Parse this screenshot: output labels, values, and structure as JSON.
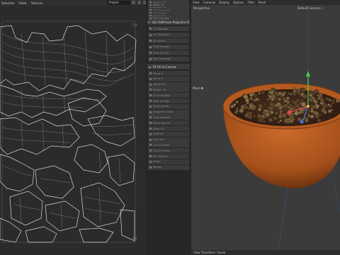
{
  "uv_editor": {
    "menu": [
      "Selection",
      "Fields",
      "Textures"
    ],
    "dropdown": "Project",
    "tick_top": "1.0",
    "tick_bottom": "1.0"
  },
  "operator_panel": {
    "items_top": [
      "Unfold UVs",
      "Relax UV",
      "Realign UV",
      "Fit UV Islands",
      "UV Islands",
      "Orient UV",
      "Fit to Canvas"
    ],
    "section1_title": "Set UVW from Projection",
    "items_mid": [
      "UV Manager",
      "UV Transform",
      "UV Layout",
      "UVW Remesh",
      "Snap to Grid",
      "Flip Horizontal"
    ],
    "section2_title": "Fit UV to Canvas",
    "items_bottom": [
      "Mirror U",
      "Mirror V",
      "Rotate 90",
      "Rotate -90",
      "UV Straighten",
      "Align to Edge",
      "Stack Islands",
      "Straighten Shell",
      "Unify Normals",
      "Mirror Islands",
      "Scale UV",
      "Shift UV",
      "Sew UVs",
      "Cut UV Seam",
      "Cut All Seams",
      "Pin Vertices",
      "Unpin",
      "Remap"
    ]
  },
  "viewport": {
    "menu": [
      "View",
      "Cameras",
      "Display",
      "Options",
      "Filter",
      "Panel"
    ],
    "view_label": "Perspective",
    "camera_label": "Default Camera ○",
    "tool_label": "Move",
    "footer": "View Transform: Scene"
  },
  "colors": {
    "bowl": "#b2581f",
    "bowl_rim": "#c8692a",
    "soil": "#3a2418",
    "axis_x": "#e24a4a",
    "axis_y": "#4ad04a",
    "axis_z": "#4a7ae2"
  },
  "icons": [
    "gear-icon",
    "dot-icon",
    "chevron-icon"
  ]
}
